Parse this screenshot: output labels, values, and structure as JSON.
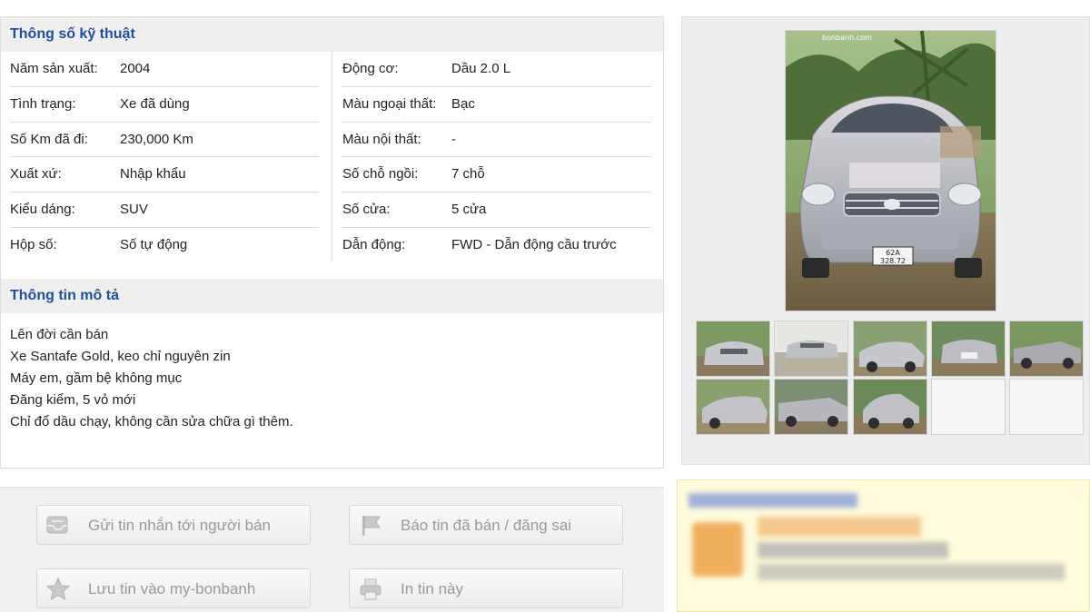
{
  "specs": {
    "heading": "Thông số kỹ thuật",
    "left": [
      {
        "label": "Năm sản xuất:",
        "value": "2004"
      },
      {
        "label": "Tình trạng:",
        "value": "Xe đã dùng"
      },
      {
        "label": "Số Km đã đi:",
        "value": "230,000 Km"
      },
      {
        "label": "Xuất xứ:",
        "value": "Nhập khẩu"
      },
      {
        "label": "Kiểu dáng:",
        "value": "SUV"
      },
      {
        "label": "Hộp số:",
        "value": "Số tự động"
      }
    ],
    "right": [
      {
        "label": "Động cơ:",
        "value": "Dầu 2.0 L"
      },
      {
        "label": "Màu ngoại thất:",
        "value": "Bạc"
      },
      {
        "label": "Màu nội thất:",
        "value": "-"
      },
      {
        "label": "Số chỗ ngồi:",
        "value": "7 chỗ"
      },
      {
        "label": "Số cửa:",
        "value": "5 cửa"
      },
      {
        "label": "Dẫn động:",
        "value": "FWD - Dẫn động cầu trước"
      }
    ]
  },
  "description": {
    "heading": "Thông tin mô tả",
    "lines": [
      "Lên đời cần bán",
      "Xe Santafe Gold, keo chỉ nguyên zin",
      "Máy em, gầm bệ không mục",
      "Đăng kiểm, 5 vỏ mới",
      "Chỉ đổ dầu chạy, không cần sửa chữa gì thêm."
    ]
  },
  "actions": {
    "message_seller": {
      "label": "Gửi tin nhắn tới người bán",
      "icon": "message-icon"
    },
    "report": {
      "label": "Báo tin đã bán / đăng sai",
      "icon": "flag-icon"
    },
    "save": {
      "label": "Lưu tin vào my-bonbanh",
      "icon": "star-icon"
    },
    "print": {
      "label": "In tin này",
      "icon": "printer-icon"
    }
  },
  "gallery": {
    "watermark": "bonbanh.com",
    "plate": [
      "62A",
      "328.72"
    ],
    "thumb_count": 8,
    "empty_slots": 2
  },
  "colors": {
    "heading_blue": "#1e4f9a",
    "section_bg": "#efefef",
    "seller_bg": "#fffbdc"
  }
}
